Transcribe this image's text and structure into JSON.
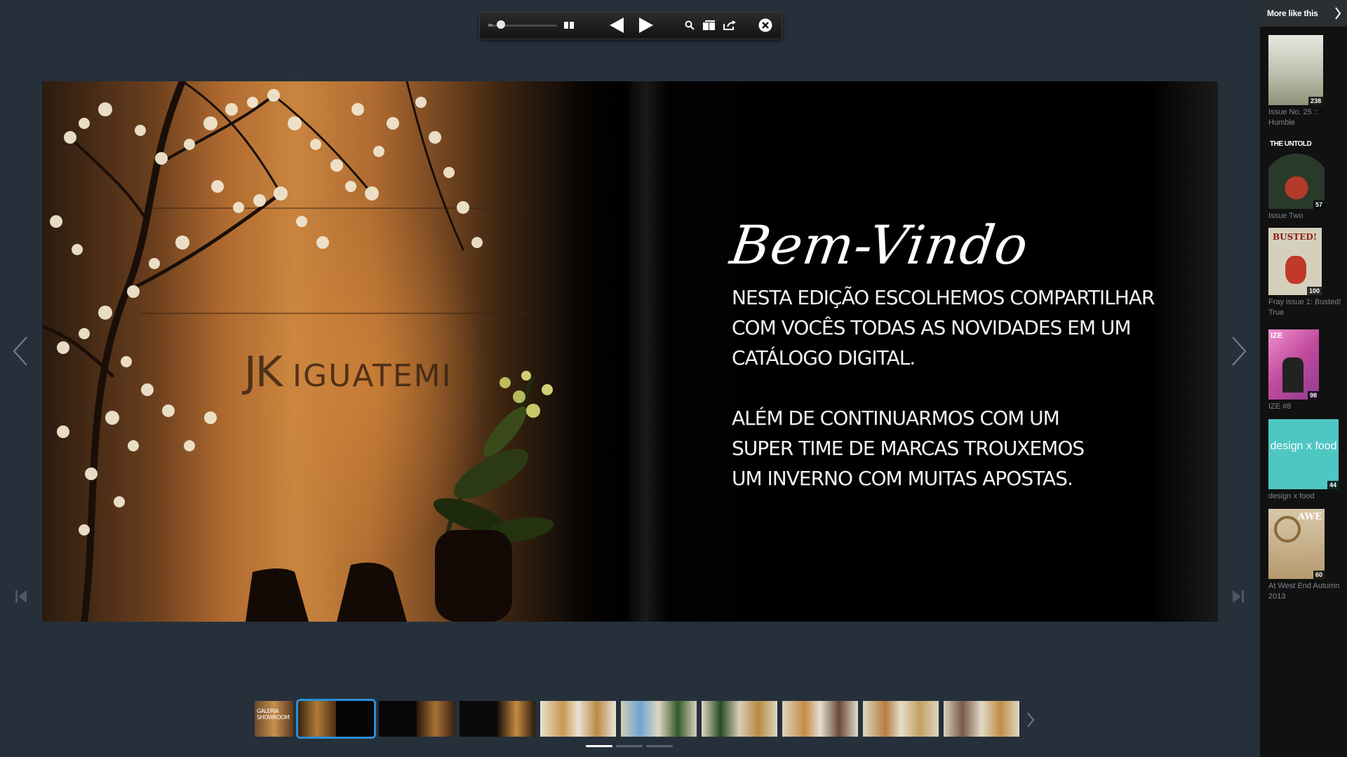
{
  "toolbar": {
    "zoom_label": "zoom-slider",
    "icons": [
      "grid-icon",
      "prev-page-icon",
      "next-page-icon",
      "search-icon",
      "pages-icon",
      "share-icon",
      "close-icon"
    ]
  },
  "spread": {
    "left_page": {
      "sign_initials": "JK",
      "sign_text": "IGUATEMI"
    },
    "right_page": {
      "headline": "Bem-Vindo",
      "paragraph1": [
        "NESTA EDIÇÃO ESCOLHEMOS COMPARTILHAR",
        "COM VOCÊS TODAS AS NOVIDADES EM UM",
        "CATÁLOGO DIGITAL."
      ],
      "paragraph2": [
        "ALÉM DE CONTINUARMOS COM UM",
        "SUPER TIME DE MARCAS TROUXEMOS",
        "UM INVERNO COM MUITAS APOSTAS."
      ]
    }
  },
  "thumbnails": {
    "first_label": "GALERIA SHOWROOM",
    "selected_index": 1,
    "count": 10
  },
  "pagination": {
    "dots": 3,
    "active": 0
  },
  "sidebar": {
    "header": "More like this",
    "items": [
      {
        "title": "Issue No. 25 :: Humble",
        "count": "238",
        "color": "#cfd2c8"
      },
      {
        "title": "Issue Two",
        "count": "57",
        "color": "#1d1d1d",
        "cover_text": "THE UNTOLD"
      },
      {
        "title": "Fray issue 1: Busted! True",
        "count": "100",
        "color": "#cfcab6",
        "cover_text": "BUSTED!"
      },
      {
        "title": "IZE #8",
        "count": "98",
        "color": "#d95fb0",
        "cover_text": "IZE"
      },
      {
        "title": "design x food",
        "count": "44",
        "color": "#4ec7c2",
        "cover_text": "design x food"
      },
      {
        "title": "At West End Autumn 2013",
        "count": "60",
        "color": "#c9b79c",
        "cover_text": "AWE"
      }
    ]
  }
}
